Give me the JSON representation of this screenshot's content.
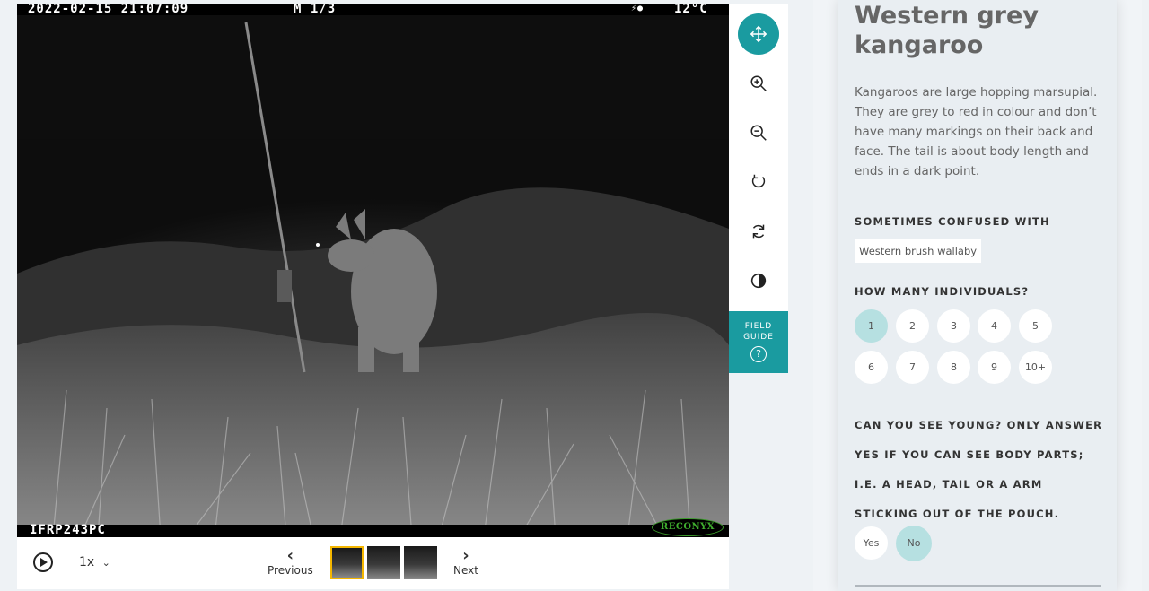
{
  "camera": {
    "datetime": "2022-02-15 21:07:09",
    "mode": "M 1/3",
    "temperature": "12°C",
    "camera_id": "IFRP243PC",
    "brand": "RECONYX"
  },
  "controls": {
    "speed": "1x",
    "previous_label": "Previous",
    "next_label": "Next"
  },
  "toolbar": {
    "field_guide_label_1": "FIELD",
    "field_guide_label_2": "GUIDE",
    "field_guide_icon": "?"
  },
  "species": {
    "name": "Western grey kangaroo",
    "description": "Kangaroos are large hopping marsupial. They are grey to red in colour and don’t have many markings on their back and face. The tail is about body length and ends in a dark point.",
    "confused_heading": "SOMETIMES CONFUSED WITH",
    "confused_with": "Western brush wallaby"
  },
  "individuals": {
    "heading": "HOW MANY INDIVIDUALS?",
    "options": [
      "1",
      "2",
      "3",
      "4",
      "5",
      "6",
      "7",
      "8",
      "9",
      "10+"
    ],
    "selected": "1"
  },
  "young": {
    "question": "CAN YOU SEE YOUNG? ONLY ANSWER YES IF YOU CAN SEE BODY PARTS; I.E. A HEAD, TAIL OR A ARM STICKING OUT OF THE POUCH.",
    "yes_label": "Yes",
    "no_label": "No",
    "selected": "No"
  },
  "colors": {
    "accent": "#1a9ba0",
    "selected_option": "#b6e0e1",
    "thumbnail_highlight": "#f5b700"
  }
}
